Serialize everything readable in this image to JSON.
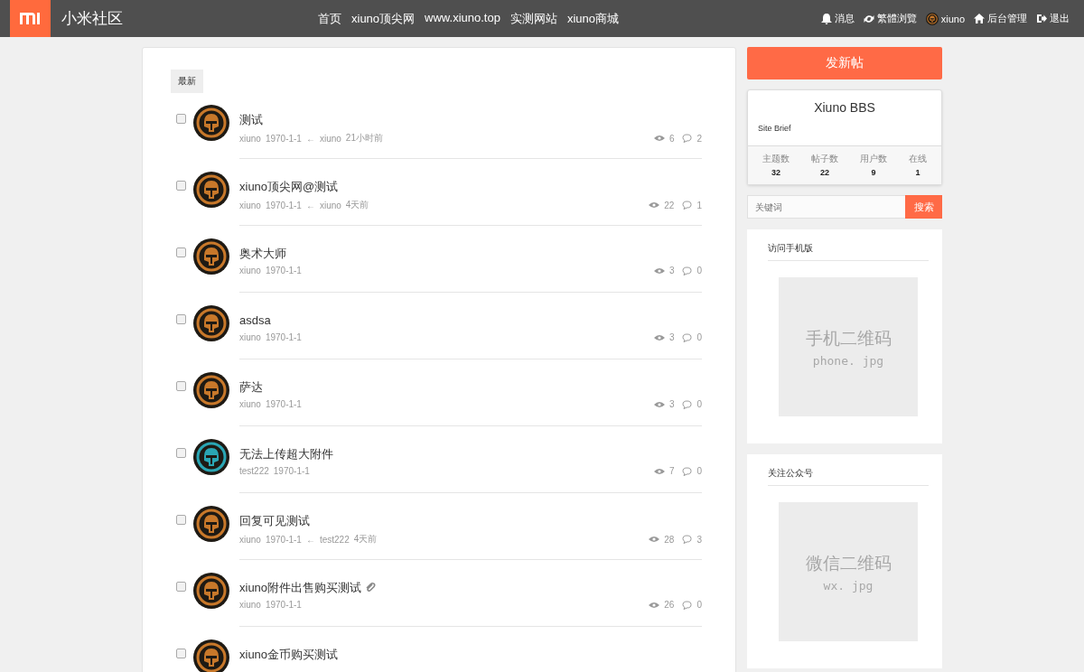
{
  "header": {
    "brand": "小米社区",
    "nav": [
      {
        "label": "首页"
      },
      {
        "label": "xiuno顶尖网"
      },
      {
        "label": "www.xiuno.top"
      },
      {
        "label": "实测网站"
      },
      {
        "label": "xiuno商城"
      }
    ],
    "user_menu": [
      {
        "kind": "bell",
        "label": "消息"
      },
      {
        "kind": "refresh",
        "label": "繁體浏覽"
      },
      {
        "kind": "avatar",
        "label": "xiuno"
      },
      {
        "kind": "home",
        "label": "后台管理"
      },
      {
        "kind": "logout",
        "label": "退出"
      }
    ]
  },
  "main": {
    "tabs": [
      {
        "label": "最新",
        "selected": true
      }
    ],
    "threads": [
      {
        "title": "测试",
        "color": "#c8782a",
        "checked": false,
        "author": "xiuno",
        "date": "1970-1-1",
        "last_reply": {
          "arrow": "←",
          "user": "xiuno",
          "time": "21小时前"
        },
        "views": "6",
        "replies": "2"
      },
      {
        "title": "xiuno顶尖网@测试",
        "color": "#c8782a",
        "checked": false,
        "author": "xiuno",
        "date": "1970-1-1",
        "last_reply": {
          "arrow": "←",
          "user": "xiuno",
          "time": "4天前"
        },
        "views": "22",
        "replies": "1"
      },
      {
        "title": "奥术大师",
        "color": "#c8782a",
        "checked": false,
        "author": "xiuno",
        "date": "1970-1-1",
        "views": "3",
        "replies": "0"
      },
      {
        "title": "asdsa",
        "color": "#c8782a",
        "checked": false,
        "author": "xiuno",
        "date": "1970-1-1",
        "views": "3",
        "replies": "0"
      },
      {
        "title": "萨达",
        "color": "#c8782a",
        "checked": false,
        "author": "xiuno",
        "date": "1970-1-1",
        "views": "3",
        "replies": "0"
      },
      {
        "title": "无法上传超大附件",
        "color": "#2aa6b4",
        "checked": false,
        "author": "test222",
        "date": "1970-1-1",
        "views": "7",
        "replies": "0"
      },
      {
        "title": "回复可见测试",
        "color": "#c8782a",
        "checked": false,
        "author": "xiuno",
        "date": "1970-1-1",
        "last_reply": {
          "arrow": "←",
          "user": "test222",
          "time": "4天前"
        },
        "views": "28",
        "replies": "3"
      },
      {
        "title": "xiuno附件出售购买测试",
        "attachment": true,
        "color": "#c8782a",
        "checked": false,
        "author": "xiuno",
        "date": "1970-1-1",
        "views": "26",
        "replies": "0"
      },
      {
        "title": "xiuno金币购买测试",
        "color": "#c8782a",
        "checked": false
      }
    ]
  },
  "sidebar": {
    "new_post_button": "发新帖",
    "site": {
      "name": "Xiuno BBS",
      "brief": "Site Brief",
      "stats": [
        {
          "label": "主题数",
          "value": "32"
        },
        {
          "label": "帖子数",
          "value": "22"
        },
        {
          "label": "用户数",
          "value": "9"
        },
        {
          "label": "在线",
          "value": "1"
        }
      ]
    },
    "search": {
      "placeholder": "关键词",
      "button": "搜索"
    },
    "widgets": [
      {
        "title": "访问手机版",
        "image_title": "手机二维码",
        "image_file": "phone. jpg"
      },
      {
        "title": "关注公众号",
        "image_title": "微信二维码",
        "image_file": "wx. jpg"
      }
    ]
  }
}
